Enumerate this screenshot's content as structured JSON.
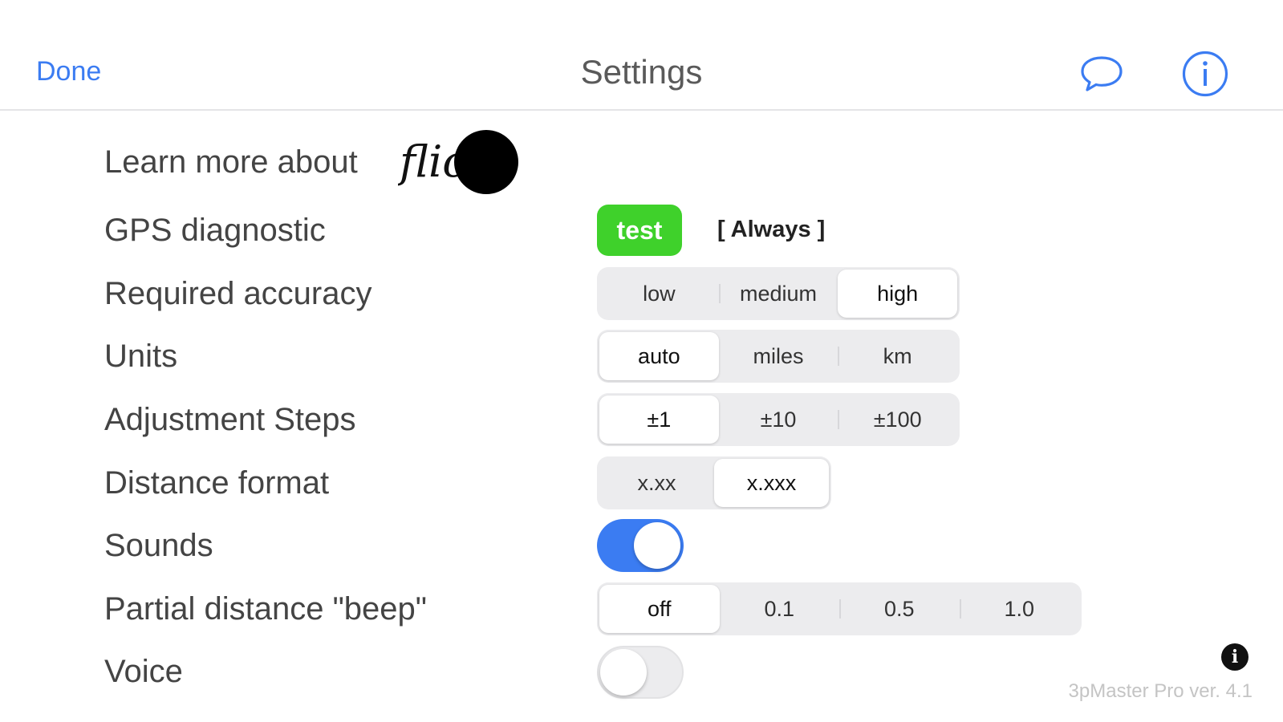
{
  "navbar": {
    "done_label": "Done",
    "title": "Settings",
    "chat_icon": "chat-bubble-icon",
    "info_icon": "info-circle-icon"
  },
  "flic": {
    "label": "Learn more about",
    "logo_text": "flic"
  },
  "gps": {
    "label": "GPS diagnostic",
    "test_label": "test",
    "status": "[ Always ]"
  },
  "accuracy": {
    "label": "Required accuracy",
    "options": [
      "low",
      "medium",
      "high"
    ],
    "selected": "high"
  },
  "units": {
    "label": "Units",
    "options": [
      "auto",
      "miles",
      "km"
    ],
    "selected": "auto"
  },
  "steps": {
    "label": "Adjustment Steps",
    "options": [
      "±1",
      "±10",
      "±100"
    ],
    "selected": "±1"
  },
  "distance_format": {
    "label": "Distance format",
    "options": [
      "x.xx",
      "x.xxx"
    ],
    "selected": "x.xxx"
  },
  "sounds": {
    "label": "Sounds",
    "enabled": true
  },
  "beep": {
    "label": "Partial distance \"beep\"",
    "options": [
      "off",
      "0.1",
      "0.5",
      "1.0"
    ],
    "selected": "off"
  },
  "voice": {
    "label": "Voice",
    "enabled": false
  },
  "footer": {
    "info_icon": "info-icon",
    "version": "3pMaster Pro ver. 4.1"
  },
  "colors": {
    "accent": "#3b7cf2",
    "test_green": "#3fd12b",
    "segment_bg": "#ececee"
  }
}
